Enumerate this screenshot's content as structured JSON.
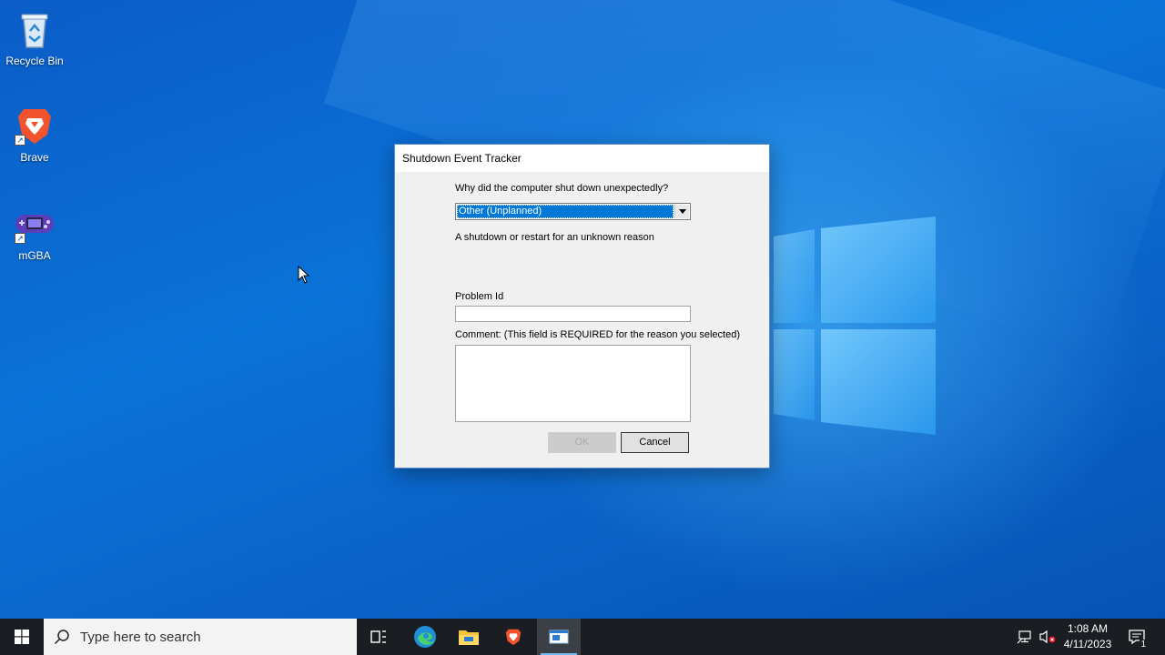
{
  "desktop": {
    "icons": [
      {
        "label": "Recycle Bin",
        "icon": "recycle-bin-icon"
      },
      {
        "label": "Brave",
        "icon": "brave-icon"
      },
      {
        "label": "mGBA",
        "icon": "mgba-icon"
      }
    ]
  },
  "dialog": {
    "title": "Shutdown Event Tracker",
    "question": "Why did the computer shut down unexpectedly?",
    "reason_selected": "Other (Unplanned)",
    "reason_description": "A shutdown or restart for an unknown reason",
    "problem_id_label": "Problem Id",
    "problem_id_value": "",
    "comment_label": "Comment: (This field is REQUIRED for the reason you selected)",
    "comment_value": "",
    "ok_label": "OK",
    "cancel_label": "Cancel"
  },
  "taskbar": {
    "search_placeholder": "Type here to search",
    "pinned": [
      "task-view-icon",
      "edge-icon",
      "file-explorer-icon",
      "brave-icon",
      "shutdown-tracker-icon"
    ],
    "time": "1:08 AM",
    "date": "4/11/2023",
    "notification_count": "1"
  },
  "colors": {
    "accent": "#0078d7",
    "taskbar": "#1a1d22",
    "desktop": "#0a64c8"
  }
}
